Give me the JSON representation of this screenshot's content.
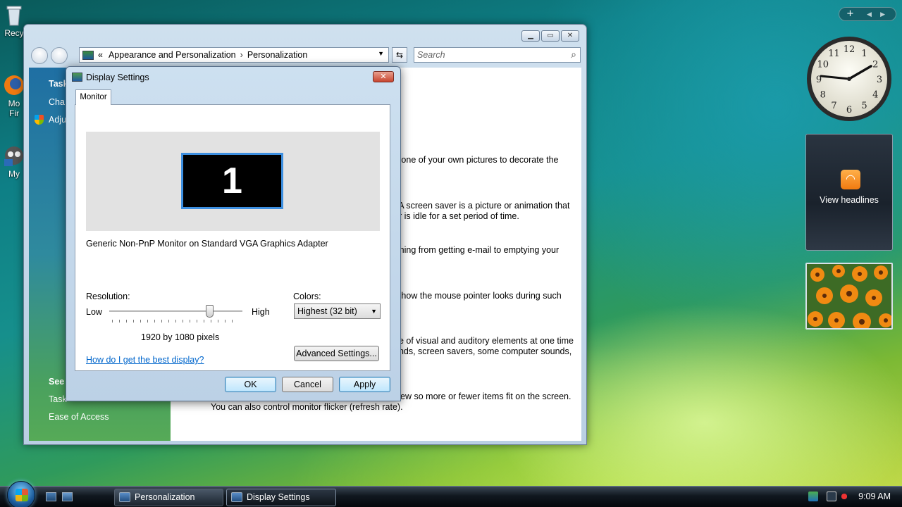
{
  "desktop": {
    "icons": [
      {
        "label": "Recy"
      },
      {
        "label": "Mo\nFir"
      },
      {
        "label": "My"
      }
    ]
  },
  "explorer": {
    "breadcrumb": [
      "Appearance and Personalization",
      "Personalization"
    ],
    "breadcrumb_prefix": "«",
    "search_placeholder": "Search",
    "sidebar": {
      "tasks_heading": "Task",
      "items": [
        "Cha",
        "Adju"
      ],
      "see_also_heading": "See",
      "see_also": [
        "Task",
        "Ease of Access"
      ]
    },
    "content_lines": [
      "e one of your own pictures to decorate the",
      ". A screen saver is a picture or animation that",
      "er is idle for a set period of time.",
      "rthing from getting e-mail to emptying your",
      "e how the mouse pointer looks during such",
      "ge of visual and auditory elements at one time",
      "unds, screen savers, some computer sounds,",
      "view so more or fewer items fit on the screen.",
      "You can also control monitor flicker (refresh rate)."
    ]
  },
  "dialog": {
    "title": "Display Settings",
    "tab": "Monitor",
    "monitor_number": "1",
    "monitor_description": "Generic Non-PnP Monitor on Standard VGA Graphics Adapter",
    "resolution_label": "Resolution:",
    "low": "Low",
    "high": "High",
    "resolution_value": "1920 by 1080 pixels",
    "resolution_slider_fraction": 0.75,
    "colors_label": "Colors:",
    "colors_value": "Highest (32 bit)",
    "help_link": "How do I get the best display?",
    "advanced_button": "Advanced Settings...",
    "ok": "OK",
    "cancel": "Cancel",
    "apply": "Apply"
  },
  "gadgets": {
    "feed_label": "View headlines",
    "clock_numbers": [
      "12",
      "1",
      "2",
      "3",
      "4",
      "5",
      "6",
      "7",
      "8",
      "9",
      "10",
      "11"
    ]
  },
  "taskbar": {
    "buttons": [
      "Personalization",
      "Display Settings"
    ],
    "time": "9:09 AM"
  },
  "colors": {
    "accent": "#3d8fe0",
    "link": "#0066cc"
  }
}
